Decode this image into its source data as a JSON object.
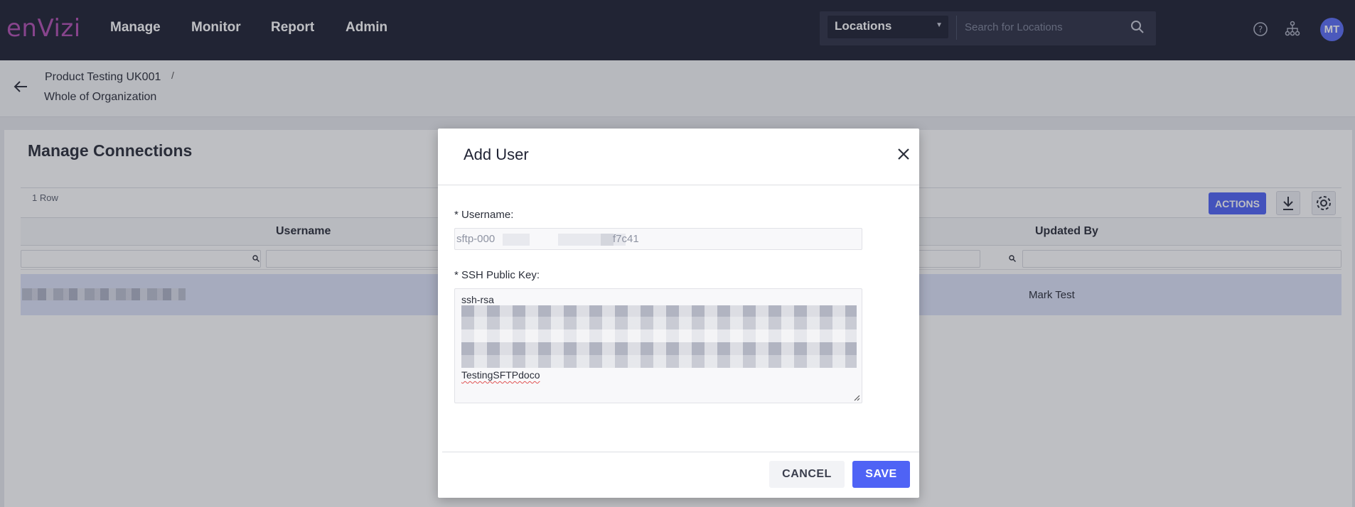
{
  "app": {
    "logo_text": "enVizi",
    "brand_color": "#b04fb0",
    "accent_color": "#4f63f5"
  },
  "topnav": {
    "items": [
      {
        "label": "Manage"
      },
      {
        "label": "Monitor"
      },
      {
        "label": "Report"
      },
      {
        "label": "Admin"
      }
    ],
    "location_select": {
      "value": "Locations"
    },
    "location_search": {
      "placeholder": "Search for Locations"
    },
    "icons": [
      "help-icon",
      "hierarchy-icon"
    ],
    "avatar_initials": "MT"
  },
  "breadcrumb": {
    "parent": "Product Testing UK001",
    "separator": "/",
    "current": "Whole of Organization"
  },
  "page": {
    "title": "Manage Connections",
    "row_count": "1 Row",
    "actions_label": "ACTIONS",
    "toolbar_icons": [
      "download-icon",
      "settings-icon"
    ],
    "columns": [
      "Username",
      "Updated By"
    ],
    "rows": [
      {
        "username": "",
        "updated_by": "Mark Test"
      }
    ]
  },
  "modal": {
    "title": "Add User",
    "username_label": "* Username:",
    "username_prefix": "sftp-000",
    "username_suffix": "f7c41",
    "ssh_label": "* SSH Public Key:",
    "ssh_first_line": "ssh-rsa",
    "ssh_last_line": "TestingSFTPdoco",
    "cancel_label": "CANCEL",
    "save_label": "SAVE"
  }
}
